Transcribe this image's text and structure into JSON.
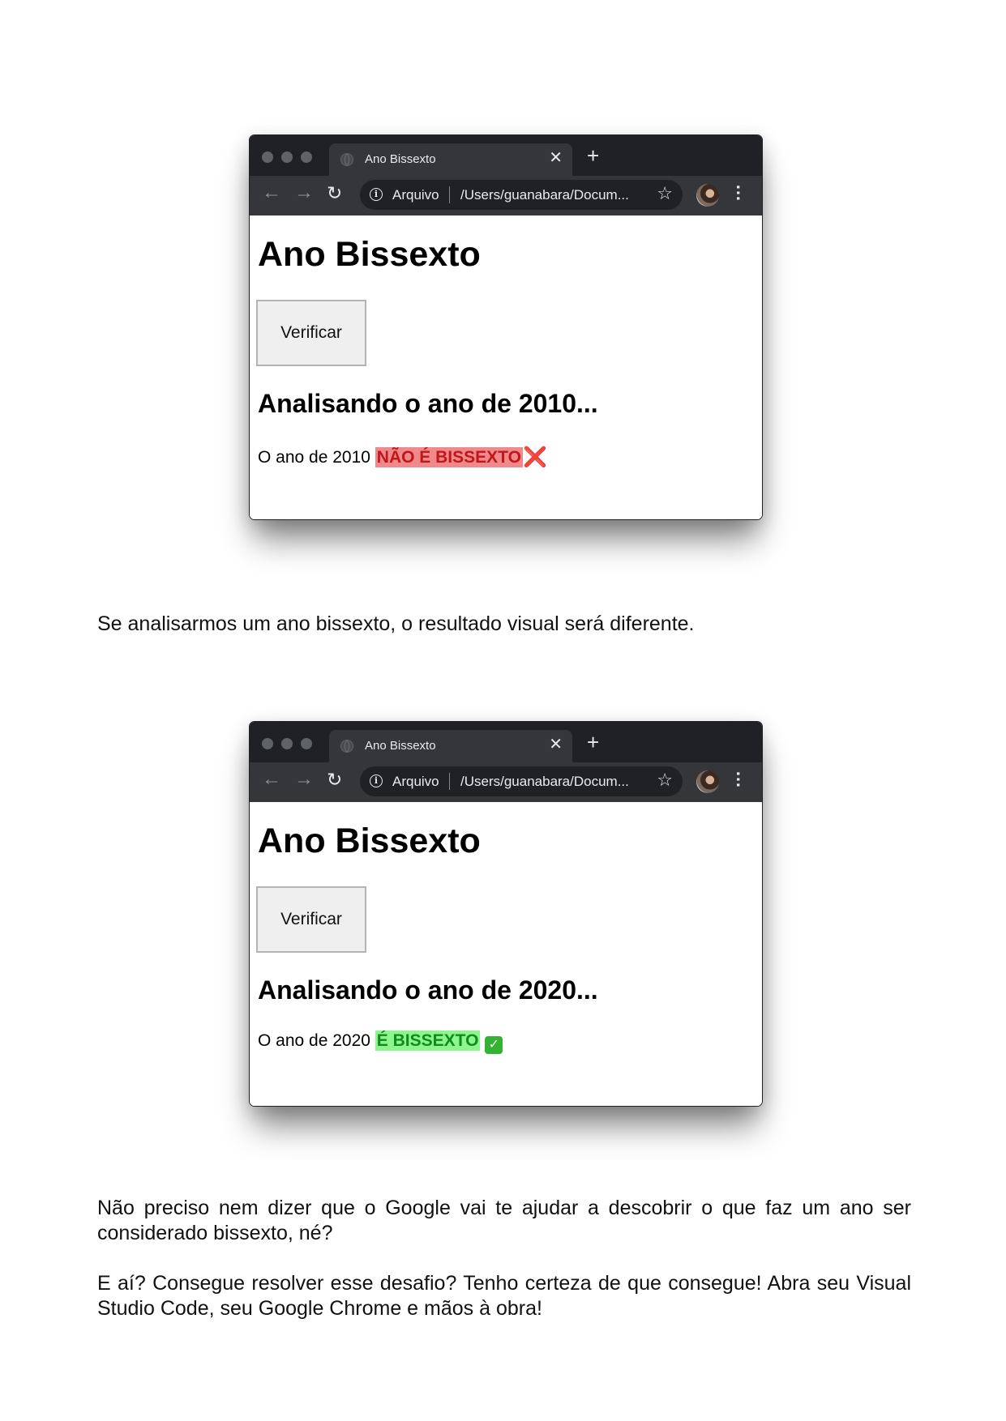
{
  "browser_1": {
    "tab_title": "Ano Bissexto",
    "omnibox": {
      "scheme_label": "Arquivo",
      "url": "/Users/guanabara/Docum..."
    },
    "page": {
      "heading": "Ano Bissexto",
      "button_label": "Verificar",
      "subheading": "Analisando o ano de 2010...",
      "result_prefix": "O ano de 2010",
      "result_badge": "NÃO É BISSEXTO",
      "result_mark": "❌"
    }
  },
  "paragraph_1": "Se analisarmos um ano bissexto, o resultado visual será diferente.",
  "browser_2": {
    "tab_title": "Ano Bissexto",
    "omnibox": {
      "scheme_label": "Arquivo",
      "url": "/Users/guanabara/Docum..."
    },
    "page": {
      "heading": "Ano Bissexto",
      "button_label": "Verificar",
      "subheading": "Analisando o ano de 2020...",
      "result_prefix": "O ano de 2020",
      "result_badge": "É BISSEXTO",
      "result_mark": "✅"
    }
  },
  "paragraph_2": "Não preciso nem dizer que o Google vai te ajudar a descobrir o que faz um ano ser considerado bissexto, né?",
  "paragraph_3": "E aí? Consegue resolver esse desafio? Tenho certeza de que consegue! Abra seu Visual Studio Code, seu Google Chrome e mãos à obra!",
  "colors": {
    "chrome_dark": "#202124",
    "chrome_toolbar": "#35363a",
    "not_leap_highlight": "#f08a8a",
    "not_leap_text": "#c0161c",
    "leap_highlight": "#8df58d",
    "leap_text": "#138a1c"
  },
  "icons": {
    "tab_favicon": "globe-icon",
    "close_tab": "close-icon",
    "new_tab": "plus-icon",
    "back": "arrow-left-icon",
    "forward": "arrow-right-icon",
    "reload": "reload-icon",
    "site_info": "info-icon",
    "bookmark": "star-icon",
    "profile": "avatar",
    "menu": "kebab-menu-icon"
  }
}
